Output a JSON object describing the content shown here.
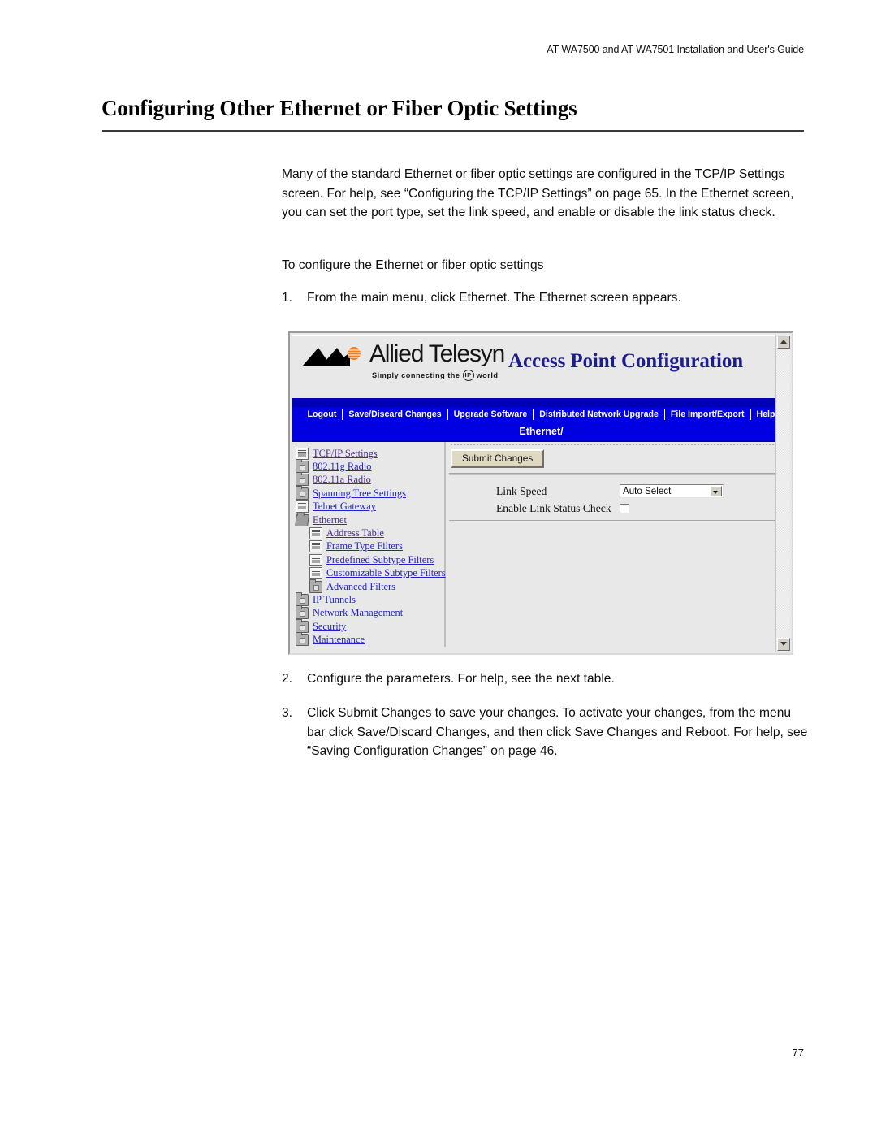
{
  "document": {
    "running_header": "AT-WA7500 and AT-WA7501 Installation and User's Guide",
    "chapter_title": "Configuring Other Ethernet or Fiber Optic Settings",
    "page_number": "77",
    "paragraphs": {
      "intro": "Many of the standard Ethernet or fiber optic settings are configured in the TCP/IP Settings screen. For help, see “Configuring the TCP/IP Settings” on page 65. In the Ethernet screen, you can set the port type, set the link speed, and enable or disable the link status check.",
      "lead_in": "To configure the Ethernet or fiber optic settings"
    },
    "steps": [
      {
        "number": "1.",
        "text": "From the main menu, click Ethernet. The Ethernet screen appears."
      },
      {
        "number": "2.",
        "text": "Configure the parameters. For help, see the next table."
      },
      {
        "number": "3.",
        "text": "Click Submit Changes to save your changes. To activate your changes, from the menu bar click Save/Discard Changes, and then click Save Changes and Reboot. For help, see “Saving Configuration Changes” on page 46."
      }
    ]
  },
  "screenshot": {
    "banner": {
      "logo_word": "Allied Telesyn",
      "logo_tagline_before": "Simply connecting the",
      "logo_tagline_badge": "IP",
      "logo_tagline_after": "world",
      "title": "Access Point Configuration"
    },
    "menu": {
      "items": [
        "Logout",
        "Save/Discard Changes",
        "Upgrade Software",
        "Distributed Network Upgrade",
        "File Import/Export",
        "Help"
      ]
    },
    "breadcrumb": "Ethernet/",
    "tree": {
      "items": [
        {
          "label": "TCP/IP Settings",
          "icon": "document-icon",
          "indent": false
        },
        {
          "label": "802.11g Radio",
          "icon": "folder-icon",
          "indent": false
        },
        {
          "label": "802.11a Radio",
          "icon": "folder-icon",
          "indent": false
        },
        {
          "label": "Spanning Tree Settings",
          "icon": "folder-icon",
          "indent": false
        },
        {
          "label": "Telnet Gateway",
          "icon": "document-icon",
          "indent": false
        },
        {
          "label": "Ethernet",
          "icon": "folder-open-icon",
          "indent": false
        },
        {
          "label": "Address Table",
          "icon": "document-icon",
          "indent": true
        },
        {
          "label": "Frame Type Filters",
          "icon": "document-icon",
          "indent": true
        },
        {
          "label": "Predefined Subtype Filters",
          "icon": "document-icon",
          "indent": true
        },
        {
          "label": "Customizable Subtype Filters",
          "icon": "document-icon",
          "indent": true
        },
        {
          "label": "Advanced Filters",
          "icon": "folder-icon",
          "indent": true
        },
        {
          "label": "IP Tunnels",
          "icon": "folder-icon",
          "indent": false
        },
        {
          "label": "Network Management",
          "icon": "folder-icon",
          "indent": false
        },
        {
          "label": "Security",
          "icon": "folder-icon",
          "indent": false
        },
        {
          "label": "Maintenance",
          "icon": "folder-icon",
          "indent": false
        }
      ]
    },
    "form": {
      "submit_label": "Submit Changes",
      "link_speed_label": "Link Speed",
      "link_speed_value": "Auto Select",
      "link_status_label": "Enable Link Status Check",
      "link_status_checked": false
    },
    "colors": {
      "nav_blue": "#0000e0",
      "nav_blue_dark": "#0000b4",
      "title_navy": "#1d1d8c",
      "link_visited": "#4b2d8c",
      "chrome_gray": "#e8e8e8",
      "button_face": "#ded9c0"
    }
  }
}
